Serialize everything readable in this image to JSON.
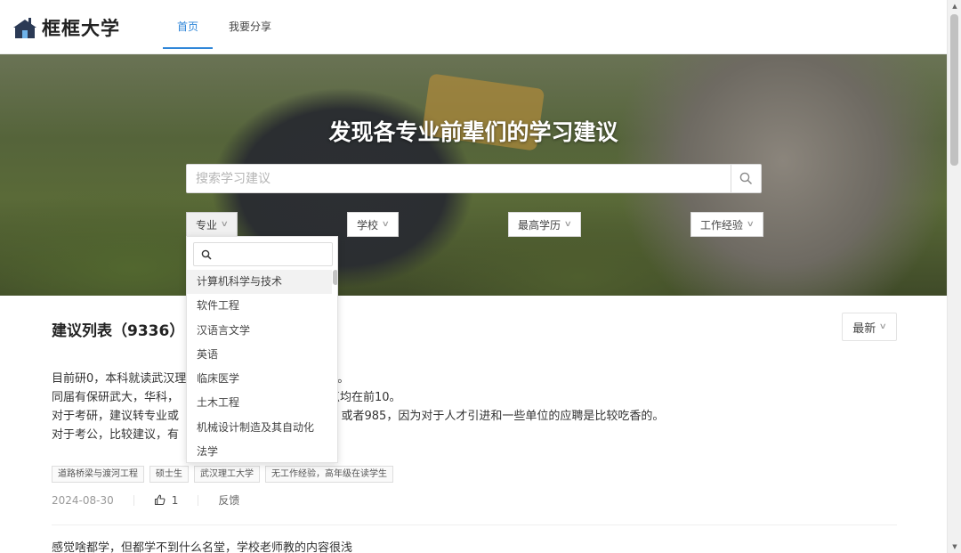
{
  "header": {
    "logo_text": "框框大学",
    "nav": [
      {
        "label": "首页",
        "active": true
      },
      {
        "label": "我要分享",
        "active": false
      }
    ]
  },
  "hero": {
    "title": "发现各专业前辈们的学习建议",
    "search": {
      "placeholder": "搜索学习建议",
      "value": ""
    },
    "filters": {
      "major": "专业",
      "school": "学校",
      "degree": "最高学历",
      "experience": "工作经验"
    }
  },
  "dropdown": {
    "search_value": "",
    "items": [
      "计算机科学与技术",
      "软件工程",
      "汉语言文学",
      "英语",
      "临床医学",
      "土木工程",
      "机械设计制造及其自动化",
      "法学"
    ],
    "hovered_index": 0
  },
  "list": {
    "title": "建议列表（9336）",
    "sort_label": "最新",
    "posts": [
      {
        "lines": [
          "目前研0，本科就读武汉理",
          "同届有保研武大，华科，",
          "对于考研，建议转专业或",
          "对于考公，比较建议，有"
        ],
        "line_tail_1": "。",
        "line_tail_2": "点均在前10。",
        "line_tail_3": "），或者985，因为对于人才引进和一些单位的应聘是比较吃香的。",
        "tags": [
          "道路桥梁与渡河工程",
          "硕士生",
          "武汉理工大学",
          "无工作经验，高年级在读学生"
        ],
        "date": "2024-08-30",
        "likes": "1",
        "feedback_label": "反馈"
      },
      {
        "preview": "感觉啥都学，但都学不到什么名堂，学校老师教的内容很浅"
      }
    ]
  },
  "colors": {
    "accent": "#2f86d8"
  }
}
